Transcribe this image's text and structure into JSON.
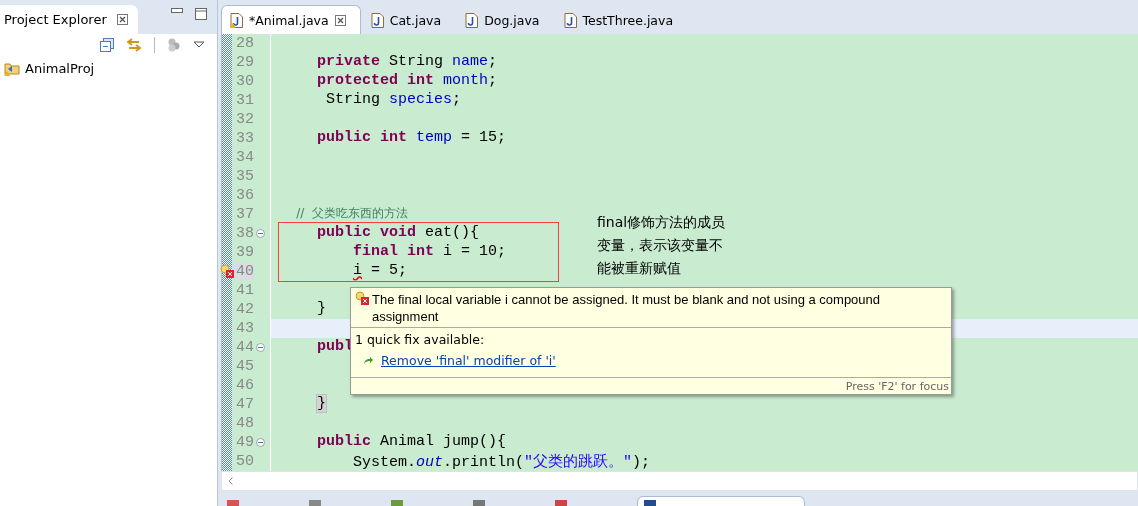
{
  "explorer": {
    "title": "Project Explorer",
    "tree": [
      {
        "label": "AnimalProj"
      }
    ]
  },
  "editor_tabs": [
    {
      "label": "*Animal.java",
      "selected": true,
      "closable": true
    },
    {
      "label": "Cat.java",
      "selected": false,
      "closable": false
    },
    {
      "label": "Dog.java",
      "selected": false,
      "closable": false
    },
    {
      "label": "TestThree.java",
      "selected": false,
      "closable": false
    }
  ],
  "code_lines": [
    {
      "number": "28",
      "current": false,
      "foldable": false,
      "error": false
    },
    {
      "number": "29",
      "current": false,
      "foldable": false,
      "error": false,
      "tokens": [
        {
          "text": "    private",
          "kind": "keyword"
        },
        {
          "text": " String ",
          "kind": "plain"
        },
        {
          "text": "name",
          "kind": "field"
        },
        {
          "text": ";",
          "kind": "plain"
        }
      ]
    },
    {
      "number": "30",
      "current": false,
      "foldable": false,
      "error": false,
      "tokens": [
        {
          "text": "    protected int",
          "kind": "keyword"
        },
        {
          "text": " month",
          "kind": "field"
        },
        {
          "text": ";",
          "kind": "plain"
        }
      ]
    },
    {
      "number": "31",
      "current": false,
      "foldable": false,
      "error": false,
      "tokens": [
        {
          "text": "     String ",
          "kind": "plain"
        },
        {
          "text": "species",
          "kind": "field"
        },
        {
          "text": ";",
          "kind": "plain"
        }
      ]
    },
    {
      "number": "32",
      "current": false,
      "foldable": false,
      "error": false
    },
    {
      "number": "33",
      "current": false,
      "foldable": false,
      "error": false,
      "tokens": [
        {
          "text": "    public int",
          "kind": "keyword"
        },
        {
          "text": " temp",
          "kind": "field"
        },
        {
          "text": " = 15;",
          "kind": "plain"
        }
      ]
    },
    {
      "number": "34",
      "current": false,
      "foldable": false,
      "error": false
    },
    {
      "number": "35",
      "current": false,
      "foldable": false,
      "error": false
    },
    {
      "number": "36",
      "current": false,
      "foldable": false,
      "error": false
    },
    {
      "number": "37",
      "current": false,
      "foldable": false,
      "error": false,
      "tokens": [
        {
          "text": "    //  父类吃东西的方法",
          "kind": "comment"
        }
      ]
    },
    {
      "number": "38",
      "current": false,
      "foldable": true,
      "error": false,
      "tokens": [
        {
          "text": "    public void",
          "kind": "keyword"
        },
        {
          "text": " eat(){",
          "kind": "plain"
        }
      ]
    },
    {
      "number": "39",
      "current": false,
      "foldable": false,
      "error": false,
      "tokens": [
        {
          "text": "        final int",
          "kind": "keyword"
        },
        {
          "text": " i = 10;",
          "kind": "plain"
        }
      ]
    },
    {
      "number": "40",
      "current": false,
      "foldable": false,
      "error": true,
      "tokens": [
        {
          "text": "        i",
          "kind": "error"
        },
        {
          "text": " = 5;",
          "kind": "plain"
        }
      ]
    },
    {
      "number": "41",
      "current": false,
      "foldable": false,
      "error": false
    },
    {
      "number": "42",
      "current": false,
      "foldable": false,
      "error": false,
      "tokens": [
        {
          "text": "    }",
          "kind": "plain"
        }
      ]
    },
    {
      "number": "43",
      "current": true,
      "foldable": false,
      "error": false
    },
    {
      "number": "44",
      "current": false,
      "foldable": true,
      "error": false,
      "tokens": [
        {
          "text": "    publ",
          "kind": "keyword"
        }
      ]
    },
    {
      "number": "45",
      "current": false,
      "foldable": false,
      "error": false
    },
    {
      "number": "46",
      "current": false,
      "foldable": false,
      "error": false
    },
    {
      "number": "47",
      "current": false,
      "foldable": false,
      "error": false,
      "tokens": [
        {
          "text": "    }",
          "kind": "bracket-match"
        }
      ]
    },
    {
      "number": "48",
      "current": false,
      "foldable": false,
      "error": false
    },
    {
      "number": "49",
      "current": false,
      "foldable": true,
      "error": false,
      "tokens": [
        {
          "text": "    public",
          "kind": "keyword"
        },
        {
          "text": " Animal jump(){",
          "kind": "plain"
        }
      ]
    },
    {
      "number": "50",
      "current": false,
      "foldable": false,
      "error": false,
      "tokens": [
        {
          "text": "        System.",
          "kind": "plain"
        },
        {
          "text": "out",
          "kind": "static"
        },
        {
          "text": ".println(",
          "kind": "plain"
        },
        {
          "text": "\"父类的跳跃。\"",
          "kind": "string"
        },
        {
          "text": ");",
          "kind": "plain"
        }
      ]
    }
  ],
  "quick_fix": {
    "message": "The final local variable i cannot be assigned. It must be blank and not using a compound assignment",
    "count": "1 quick fix available:",
    "fixes": [
      "Remove 'final' modifier of 'i'"
    ],
    "footer": "Press 'F2' for focus"
  },
  "annotation": {
    "lines": [
      "final修饰方法的成员",
      "变量，表示该变量不",
      "能被重新赋值"
    ]
  }
}
